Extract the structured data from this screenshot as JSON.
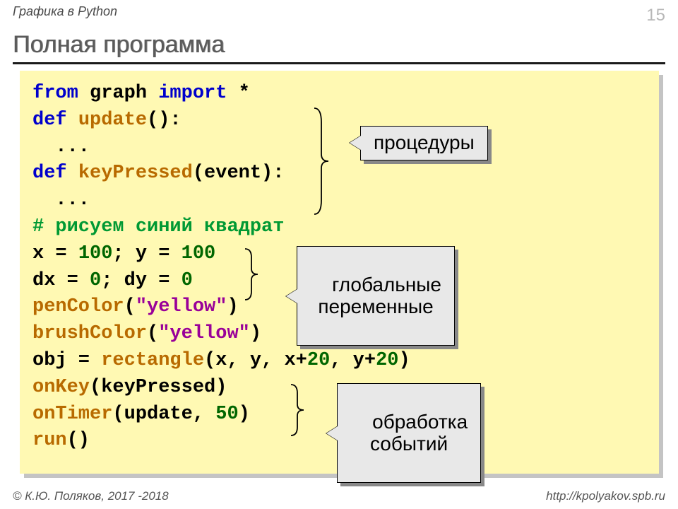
{
  "header": {
    "topic": "Графика в Python",
    "slide_number": "15"
  },
  "title": "Полная программа",
  "callouts": {
    "c1": "процедуры",
    "c2": "глобальные\nпеременные",
    "c3": "обработка\nсобытий"
  },
  "code": {
    "l1": {
      "t1": "from",
      "t2": " graph ",
      "t3": "import",
      "t4": " *"
    },
    "l2": {
      "t1": "def",
      "t2": " ",
      "t3": "update",
      "t4": "():"
    },
    "l3": "  ...",
    "l4": {
      "t1": "def",
      "t2": " ",
      "t3": "keyPressed",
      "t4": "(event):"
    },
    "l5": "  ...",
    "l6": "# рисуем синий квадрат",
    "l7": {
      "t1": "x = ",
      "t2": "100",
      "t3": "; y = ",
      "t4": "100"
    },
    "l8": {
      "t1": "dx = ",
      "t2": "0",
      "t3": "; dy = ",
      "t4": "0"
    },
    "l9": {
      "t1": "penColor",
      "t2": "(",
      "t3": "\"yellow\"",
      "t4": ")"
    },
    "l10": {
      "t1": "brushColor",
      "t2": "(",
      "t3": "\"yellow\"",
      "t4": ")"
    },
    "l11": {
      "t1": "obj = ",
      "t2": "rectangle",
      "t3": "(x, y, x+",
      "t4": "20",
      "t5": ", y+",
      "t6": "20",
      "t7": ")"
    },
    "l12": {
      "t1": "onKey",
      "t2": "(keyPressed)"
    },
    "l13": {
      "t1": "onTimer",
      "t2": "(update, ",
      "t3": "50",
      "t4": ")"
    },
    "l14": {
      "t1": "run",
      "t2": "()"
    }
  },
  "footer": {
    "left": "© К.Ю. Поляков, 2017 -2018",
    "right": "http://kpolyakov.spb.ru"
  }
}
